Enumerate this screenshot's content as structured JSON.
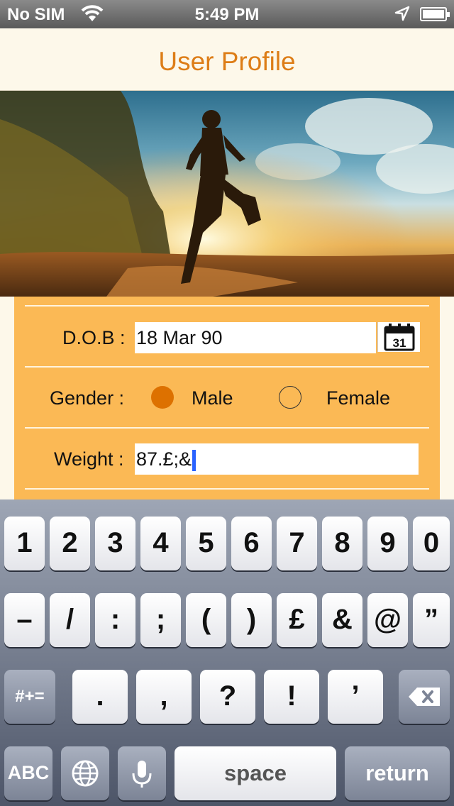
{
  "status_bar": {
    "carrier": "No SIM",
    "time": "5:49 PM"
  },
  "nav": {
    "title": "User Profile"
  },
  "hero": {
    "alt": "runner-photo"
  },
  "form": {
    "dob_label": "D.O.B :",
    "dob_value": "18 Mar 90",
    "calendar_day": "31",
    "gender_label": "Gender :",
    "gender_options": [
      "Male",
      "Female"
    ],
    "gender_selected": "Male",
    "weight_label": "Weight :",
    "weight_value": "87.£;&"
  },
  "keyboard": {
    "row1": [
      "1",
      "2",
      "3",
      "4",
      "5",
      "6",
      "7",
      "8",
      "9",
      "0"
    ],
    "row2": [
      "–",
      "/",
      ":",
      ";",
      "(",
      ")",
      "£",
      "&",
      "@",
      "”"
    ],
    "row3_mode": "#+=",
    "row3": [
      ".",
      ",",
      "?",
      "!",
      "’"
    ],
    "abc_label": "ABC",
    "space_label": "space",
    "return_label": "return"
  },
  "colors": {
    "accent": "#dd7d17",
    "panel": "#fbb955",
    "radio_on": "#dd7100"
  }
}
